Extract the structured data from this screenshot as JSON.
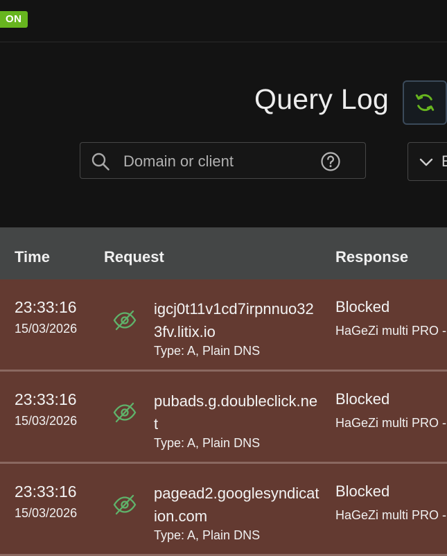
{
  "topbar": {
    "status_badge": "ON"
  },
  "header": {
    "title": "Query Log",
    "search": {
      "placeholder": "Domain or client",
      "value": ""
    },
    "filter_label": "E"
  },
  "table": {
    "columns": [
      "Time",
      "Request",
      "Response"
    ],
    "rows": [
      {
        "time": "23:33:16",
        "date": "15/03/2026",
        "domain": "igcj0t11v1cd7irpnnuo323fv.litix.io",
        "type": "Type: A, Plain DNS",
        "status": "Blocked",
        "rule": "HaGeZi multi PRO -"
      },
      {
        "time": "23:33:16",
        "date": "15/03/2026",
        "domain": "pubads.g.doubleclick.net",
        "type": "Type: A, Plain DNS",
        "status": "Blocked",
        "rule": "HaGeZi multi PRO -"
      },
      {
        "time": "23:33:16",
        "date": "15/03/2026",
        "domain": "pagead2.googlesyndication.com",
        "type": "Type: A, Plain DNS",
        "status": "Blocked",
        "rule": "HaGeZi multi PRO -"
      }
    ]
  },
  "colors": {
    "blocked_row": "#633a31",
    "accent_green": "#67b51f",
    "eye_icon": "#5fb36b"
  },
  "icons": {
    "refresh": "refresh-icon",
    "search": "search-icon",
    "help": "help-icon",
    "chevron": "chevron-down-icon",
    "visibility": "eye-off-icon"
  }
}
